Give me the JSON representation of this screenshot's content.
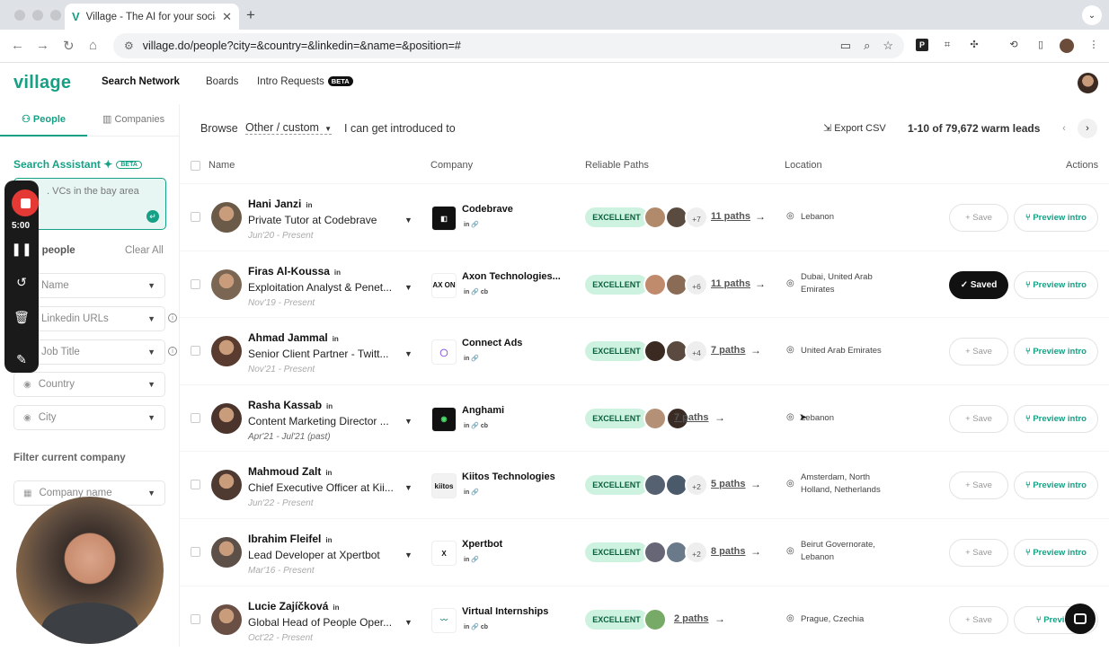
{
  "browser": {
    "tab_title": "Village - The AI for your social",
    "tab_favicon": "V",
    "url": "village.do/people?city=&country=&linkedin=&name=&position=#"
  },
  "app": {
    "logo": "village",
    "nav": {
      "search_network": "Search Network",
      "boards": "Boards",
      "intro_requests": "Intro Requests",
      "beta": "BETA"
    }
  },
  "sidebar": {
    "tabs": {
      "people": "People",
      "companies": "Companies"
    },
    "assistant": {
      "title": "Search Assistant",
      "beta": "BETA",
      "placeholder": ". VCs in the bay area"
    },
    "search_people": "ch people",
    "clear_all": "Clear All",
    "filters": {
      "name": "Name",
      "linkedin": "Linkedin URLs",
      "job_title": "Job Title",
      "country": "Country",
      "city": "City"
    },
    "filter_company_title": "Filter current company",
    "company_name": "Company name"
  },
  "recorder": {
    "time": "5:00"
  },
  "toolbar": {
    "browse": "Browse",
    "browse_option": "Other / custom",
    "browse_rest": "I can get introduced to",
    "export": "Export CSV",
    "count": "1-10 of 79,672 warm leads"
  },
  "table": {
    "headers": {
      "name": "Name",
      "company": "Company",
      "paths": "Reliable Paths",
      "location": "Location",
      "actions": "Actions"
    },
    "rows": [
      {
        "name": "Hani Janzi",
        "title": "Private Tutor at Codebrave",
        "date": "Jun'20 - Present",
        "company": "Codebrave",
        "company_icons": "in 🔗",
        "quality": "EXCELLENT",
        "plus": "+7",
        "paths": "11 paths",
        "location": "Lebanon",
        "action": "+ Save",
        "preview": "Preview intro"
      },
      {
        "name": "Firas Al-Koussa",
        "title": "Exploitation Analyst & Penet...",
        "date": "Nov'19 - Present",
        "company": "Axon Technologies...",
        "company_icons": "in 🔗 cb",
        "quality": "EXCELLENT",
        "plus": "+6",
        "paths": "11 paths",
        "location": "Dubai, United Arab Emirates",
        "action": "✓ Saved",
        "preview": "Preview intro"
      },
      {
        "name": "Ahmad Jammal",
        "title": "Senior Client Partner - Twitt...",
        "date": "Nov'21 - Present",
        "company": "Connect Ads",
        "company_icons": "in 🔗",
        "quality": "EXCELLENT",
        "plus": "+4",
        "paths": "7 paths",
        "location": "United Arab Emirates",
        "action": "+ Save",
        "preview": "Preview intro"
      },
      {
        "name": "Rasha Kassab",
        "title": "Content Marketing Director ...",
        "date": "Apr'21 - Jul'21 (past)",
        "company": "Anghami",
        "company_icons": "in 🔗 cb",
        "quality": "EXCELLENT",
        "plus": "",
        "paths": "7 paths",
        "location": "Lebanon",
        "action": "+ Save",
        "preview": "Preview intro"
      },
      {
        "name": "Mahmoud Zalt",
        "title": "Chief Executive Officer at Kii...",
        "date": "Jun'22 - Present",
        "company": "Kiitos Technologies",
        "company_icons": "in 🔗",
        "quality": "EXCELLENT",
        "plus": "+2",
        "paths": "5 paths",
        "location": "Amsterdam, North Holland, Netherlands",
        "action": "+ Save",
        "preview": "Preview intro"
      },
      {
        "name": "Ibrahim Fleifel",
        "title": "Lead Developer at Xpertbot",
        "date": "Mar'16 - Present",
        "company": "Xpertbot",
        "company_icons": "in 🔗",
        "quality": "EXCELLENT",
        "plus": "+2",
        "paths": "8 paths",
        "location": "Beirut Governorate, Lebanon",
        "action": "+ Save",
        "preview": "Preview intro"
      },
      {
        "name": "Lucie Zajíčková",
        "title": "Global Head of People Oper...",
        "date": "Oct'22 - Present",
        "company": "Virtual Internships",
        "company_icons": "in 🔗 cb",
        "quality": "EXCELLENT",
        "plus": "",
        "paths": "2 paths",
        "location": "Prague, Czechia",
        "action": "+ Save",
        "preview": "Preview"
      }
    ]
  },
  "colors": {
    "brand": "#16a085",
    "excellent_bg": "#cdf3e0",
    "record": "#e53935"
  }
}
